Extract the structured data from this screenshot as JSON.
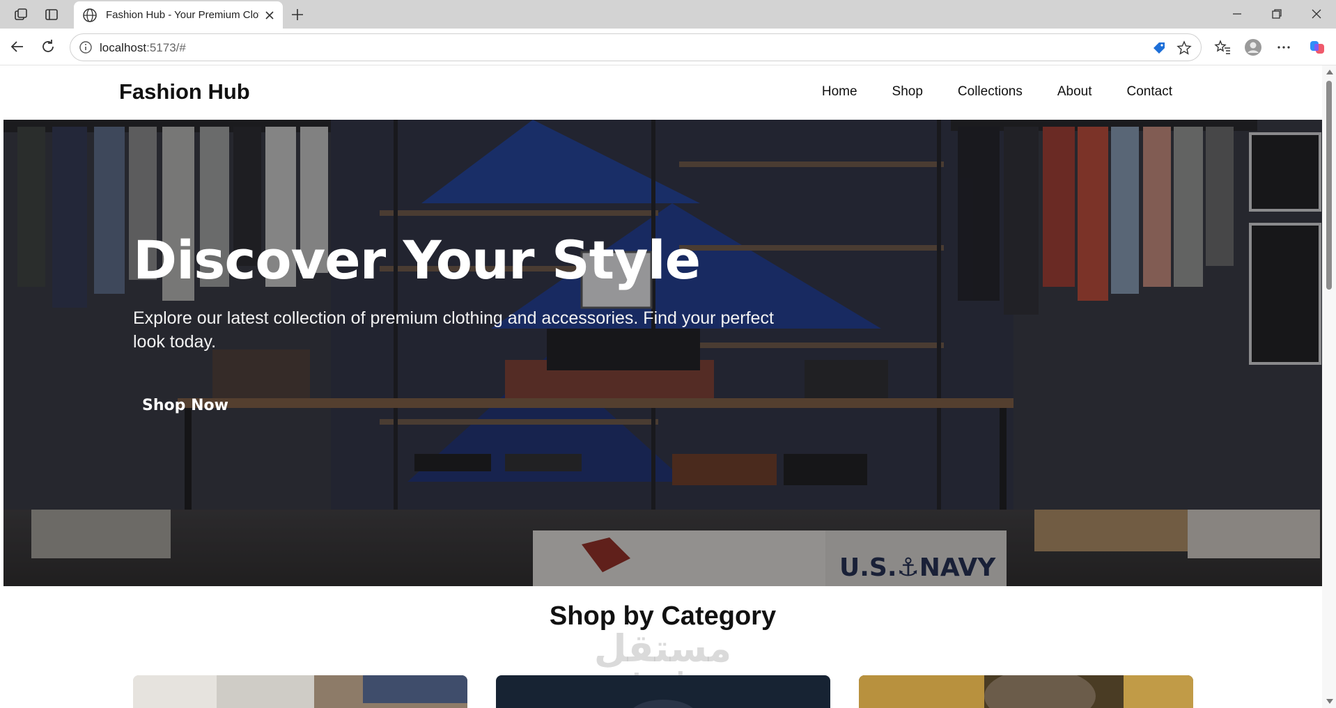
{
  "browser": {
    "tab_title": "Fashion Hub - Your Premium Clot",
    "url_host": "localhost",
    "url_rest": ":5173/#"
  },
  "site": {
    "brand": "Fashion Hub",
    "nav": [
      "Home",
      "Shop",
      "Collections",
      "About",
      "Contact"
    ]
  },
  "hero": {
    "heading": "Discover Your Style",
    "text": "Explore our latest collection of premium clothing and accessories. Find your perfect look today.",
    "cta": "Shop Now"
  },
  "categories": {
    "title": "Shop by Category"
  },
  "watermark": {
    "arabic": "مستقل",
    "latin": "mostaql.com"
  },
  "colors": {
    "chrome_bg": "#d3d3d3",
    "text_dark": "#111111",
    "hero_text": "#ffffff"
  }
}
